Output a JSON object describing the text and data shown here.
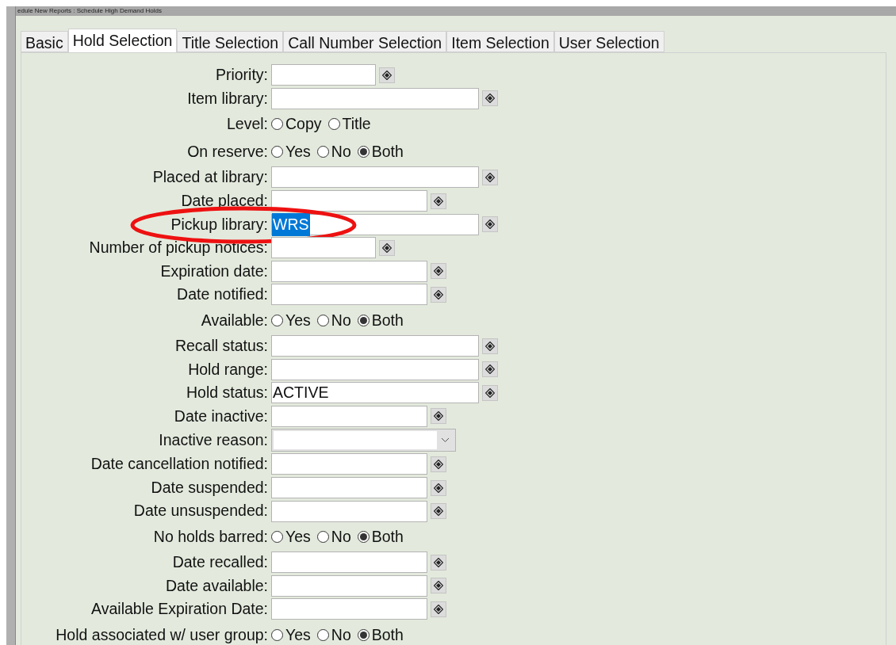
{
  "window": {
    "title": "edule New Reports : Schedule High Demand Holds"
  },
  "tabs": [
    {
      "label": "Basic",
      "selected": false
    },
    {
      "label": "Hold Selection",
      "selected": true
    },
    {
      "label": "Title Selection",
      "selected": false
    },
    {
      "label": "Call Number Selection",
      "selected": false
    },
    {
      "label": "Item Selection",
      "selected": false
    },
    {
      "label": "User Selection",
      "selected": false
    }
  ],
  "form": [
    {
      "kind": "short",
      "label": "Priority:"
    },
    {
      "kind": "long",
      "label": "Item library:"
    },
    {
      "kind": "radio",
      "label": "Level:",
      "options": [
        {
          "label": "Copy",
          "selected": false
        },
        {
          "label": "Title",
          "selected": false
        }
      ]
    },
    {
      "kind": "radio",
      "label": "On reserve:",
      "options": [
        {
          "label": "Yes",
          "selected": false
        },
        {
          "label": "No",
          "selected": false
        },
        {
          "label": "Both",
          "selected": true
        }
      ]
    },
    {
      "kind": "long",
      "label": "Placed at library:"
    },
    {
      "kind": "medium",
      "label": "Date placed:"
    },
    {
      "kind": "long",
      "label": "Pickup library:",
      "value": "WRS",
      "highlighted": true,
      "circled": true
    },
    {
      "kind": "short",
      "label": "Number of pickup notices:"
    },
    {
      "kind": "medium",
      "label": "Expiration date:"
    },
    {
      "kind": "medium",
      "label": "Date notified:"
    },
    {
      "kind": "radio",
      "label": "Available:",
      "options": [
        {
          "label": "Yes",
          "selected": false
        },
        {
          "label": "No",
          "selected": false
        },
        {
          "label": "Both",
          "selected": true
        }
      ]
    },
    {
      "kind": "long",
      "label": "Recall status:"
    },
    {
      "kind": "long",
      "label": "Hold range:"
    },
    {
      "kind": "long",
      "label": "Hold status:",
      "value": "ACTIVE",
      "highlighted": false
    },
    {
      "kind": "medium",
      "label": "Date inactive:"
    },
    {
      "kind": "select",
      "label": "Inactive reason:"
    },
    {
      "kind": "medium",
      "label": "Date cancellation notified:"
    },
    {
      "kind": "medium",
      "label": "Date suspended:"
    },
    {
      "kind": "medium",
      "label": "Date unsuspended:"
    },
    {
      "kind": "radio",
      "label": "No holds barred:",
      "options": [
        {
          "label": "Yes",
          "selected": false
        },
        {
          "label": "No",
          "selected": false
        },
        {
          "label": "Both",
          "selected": true
        }
      ]
    },
    {
      "kind": "medium",
      "label": "Date recalled:"
    },
    {
      "kind": "medium",
      "label": "Date available:"
    },
    {
      "kind": "medium",
      "label": "Available Expiration Date:"
    },
    {
      "kind": "radio",
      "label": "Hold associated w/ user group:",
      "options": [
        {
          "label": "Yes",
          "selected": false
        },
        {
          "label": "No",
          "selected": false
        },
        {
          "label": "Both",
          "selected": true
        }
      ]
    }
  ]
}
